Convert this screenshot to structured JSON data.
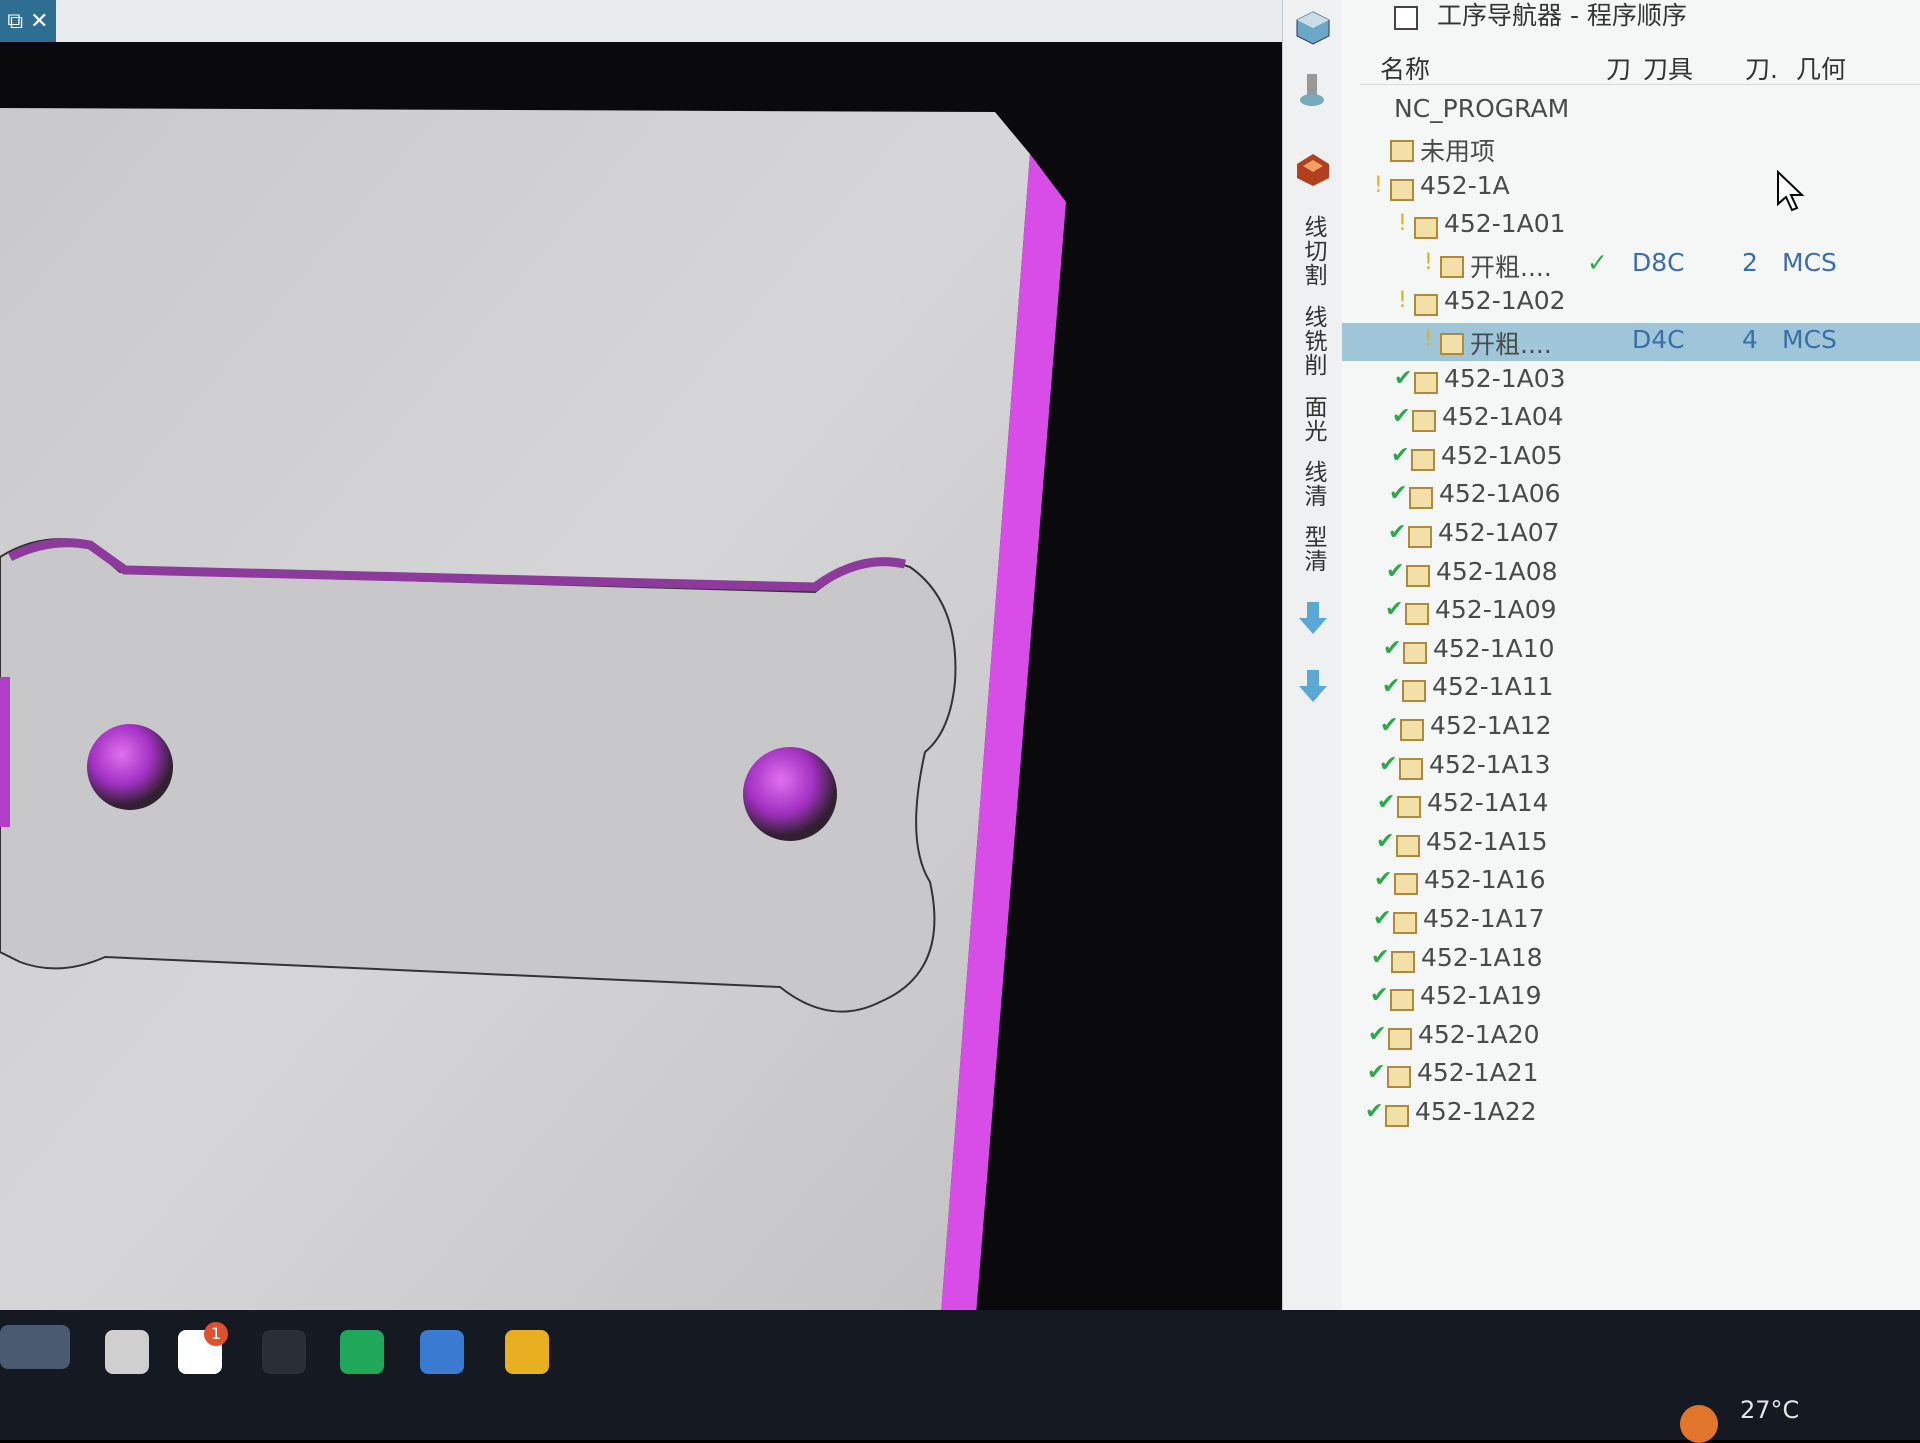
{
  "window": {
    "close_buttons": "⧉ ✕"
  },
  "panel": {
    "title": "工序导航器 - 程序顺序",
    "columns": [
      "名称",
      "刀",
      "刀具",
      "刀.",
      "几何"
    ],
    "root": "NC_PROGRAM",
    "rows": [
      {
        "name": "未用项",
        "status": "",
        "tool": "",
        "num": "",
        "geom": ""
      },
      {
        "name": "452-1A",
        "status": "warn",
        "tool": "",
        "num": "",
        "geom": ""
      },
      {
        "name": "452-1A01",
        "status": "warn",
        "tool": "",
        "num": "",
        "geom": ""
      },
      {
        "name": "开粗....",
        "status": "warn",
        "tool": "D8C",
        "num": "2",
        "geom": "MCS",
        "tool_ok": "✓"
      },
      {
        "name": "452-1A02",
        "status": "warn",
        "tool": "",
        "num": "",
        "geom": ""
      },
      {
        "name": "开粗....",
        "status": "warn",
        "tool": "D4C",
        "num": "4",
        "geom": "MCS",
        "selected": true
      },
      {
        "name": "452-1A03",
        "status": "ok"
      },
      {
        "name": "452-1A04",
        "status": "ok"
      },
      {
        "name": "452-1A05",
        "status": "ok"
      },
      {
        "name": "452-1A06",
        "status": "ok"
      },
      {
        "name": "452-1A07",
        "status": "ok"
      },
      {
        "name": "452-1A08",
        "status": "ok"
      },
      {
        "name": "452-1A09",
        "status": "ok"
      },
      {
        "name": "452-1A10",
        "status": "ok"
      },
      {
        "name": "452-1A11",
        "status": "ok"
      },
      {
        "name": "452-1A12",
        "status": "ok"
      },
      {
        "name": "452-1A13",
        "status": "ok"
      },
      {
        "name": "452-1A14",
        "status": "ok"
      },
      {
        "name": "452-1A15",
        "status": "ok"
      },
      {
        "name": "452-1A16",
        "status": "ok"
      },
      {
        "name": "452-1A17",
        "status": "ok"
      },
      {
        "name": "452-1A18",
        "status": "ok"
      },
      {
        "name": "452-1A19",
        "status": "ok"
      },
      {
        "name": "452-1A20",
        "status": "ok"
      },
      {
        "name": "452-1A21",
        "status": "ok"
      },
      {
        "name": "452-1A22",
        "status": "ok"
      }
    ]
  },
  "iconstrip": {
    "labels": [
      "线切割",
      "线铣削",
      "面光",
      "线清",
      "型清"
    ]
  },
  "taskbar": {
    "temperature": "27°C",
    "badge": "1"
  },
  "colors": {
    "accent_magenta": "#d84de8",
    "selection": "#9fc6d8",
    "ok_green": "#2aa84a"
  }
}
